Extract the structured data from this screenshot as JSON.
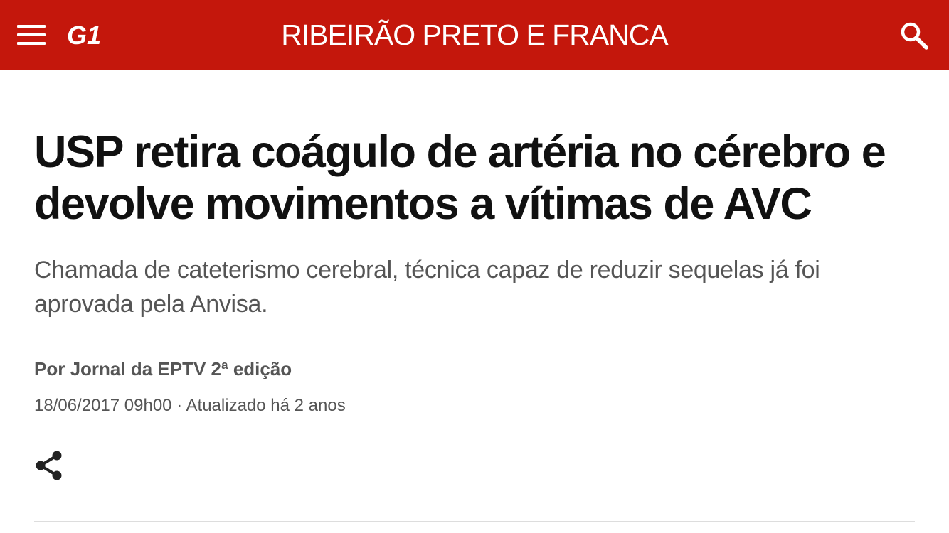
{
  "header": {
    "menu_icon": "hamburger-menu-icon",
    "logo_text": "G1",
    "region_title": "RIBEIRÃO PRETO E FRANCA",
    "search_icon": "search-icon",
    "background_color": "#c4170c"
  },
  "article": {
    "headline": "USP retira coágulo de artéria no cérebro e devolve movimentos a vítimas de AVC",
    "subtitle": "Chamada de cateterismo cerebral, técnica capaz de reduzir sequelas já foi aprovada pela Anvisa.",
    "byline": "Por Jornal da EPTV 2ª edição",
    "dateline": "18/06/2017 09h00 · Atualizado há 2 anos",
    "share_icon": "share-icon"
  }
}
